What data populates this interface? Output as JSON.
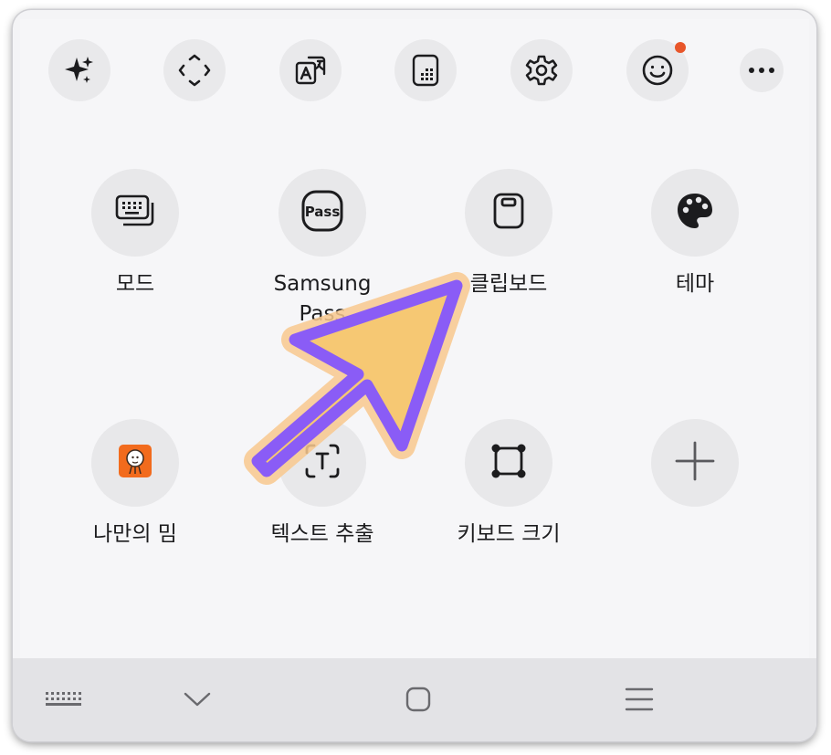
{
  "toolbar": {
    "buttons": [
      {
        "name": "galaxy-ai-sparkle",
        "icon": "sparkle-icon"
      },
      {
        "name": "cursor-move",
        "icon": "move-arrows-icon"
      },
      {
        "name": "translate",
        "icon": "translate-icon"
      },
      {
        "name": "one-handed-keyboard",
        "icon": "keypad-icon"
      },
      {
        "name": "settings",
        "icon": "gear-icon"
      },
      {
        "name": "emoji",
        "icon": "smiley-icon",
        "has_badge": true
      },
      {
        "name": "more-options",
        "icon": "more-dots-icon"
      }
    ],
    "badge_color": "#e8562a"
  },
  "tiles": {
    "mode": {
      "label": "모드",
      "icon": "keyboard-mode-icon"
    },
    "samsung_pass": {
      "label": "Samsung\nPass",
      "icon": "pass-icon",
      "icon_text": "Pass"
    },
    "clipboard": {
      "label": "클립보드",
      "icon": "clipboard-icon"
    },
    "theme": {
      "label": "테마",
      "icon": "palette-icon"
    },
    "my_meme": {
      "label": "나만의 밈",
      "icon": "meme-icon"
    },
    "text_extract": {
      "label": "텍스트 추출",
      "icon": "text-extract-icon"
    },
    "keyboard_size": {
      "label": "키보드 크기",
      "icon": "resize-frame-icon"
    },
    "add": {
      "label": "",
      "icon": "plus-icon"
    }
  },
  "nav": {
    "keyboard": {
      "icon": "keyboard-dots-icon"
    },
    "hide": {
      "icon": "chevron-down-icon"
    },
    "home": {
      "icon": "home-square-icon"
    },
    "recents": {
      "icon": "menu-lines-icon"
    }
  },
  "annotation": {
    "icon": "pointer-arrow-icon",
    "fill_color": "#f6c873",
    "outline_color": "#8a5cf6",
    "glow_color": "#f9c98f"
  }
}
